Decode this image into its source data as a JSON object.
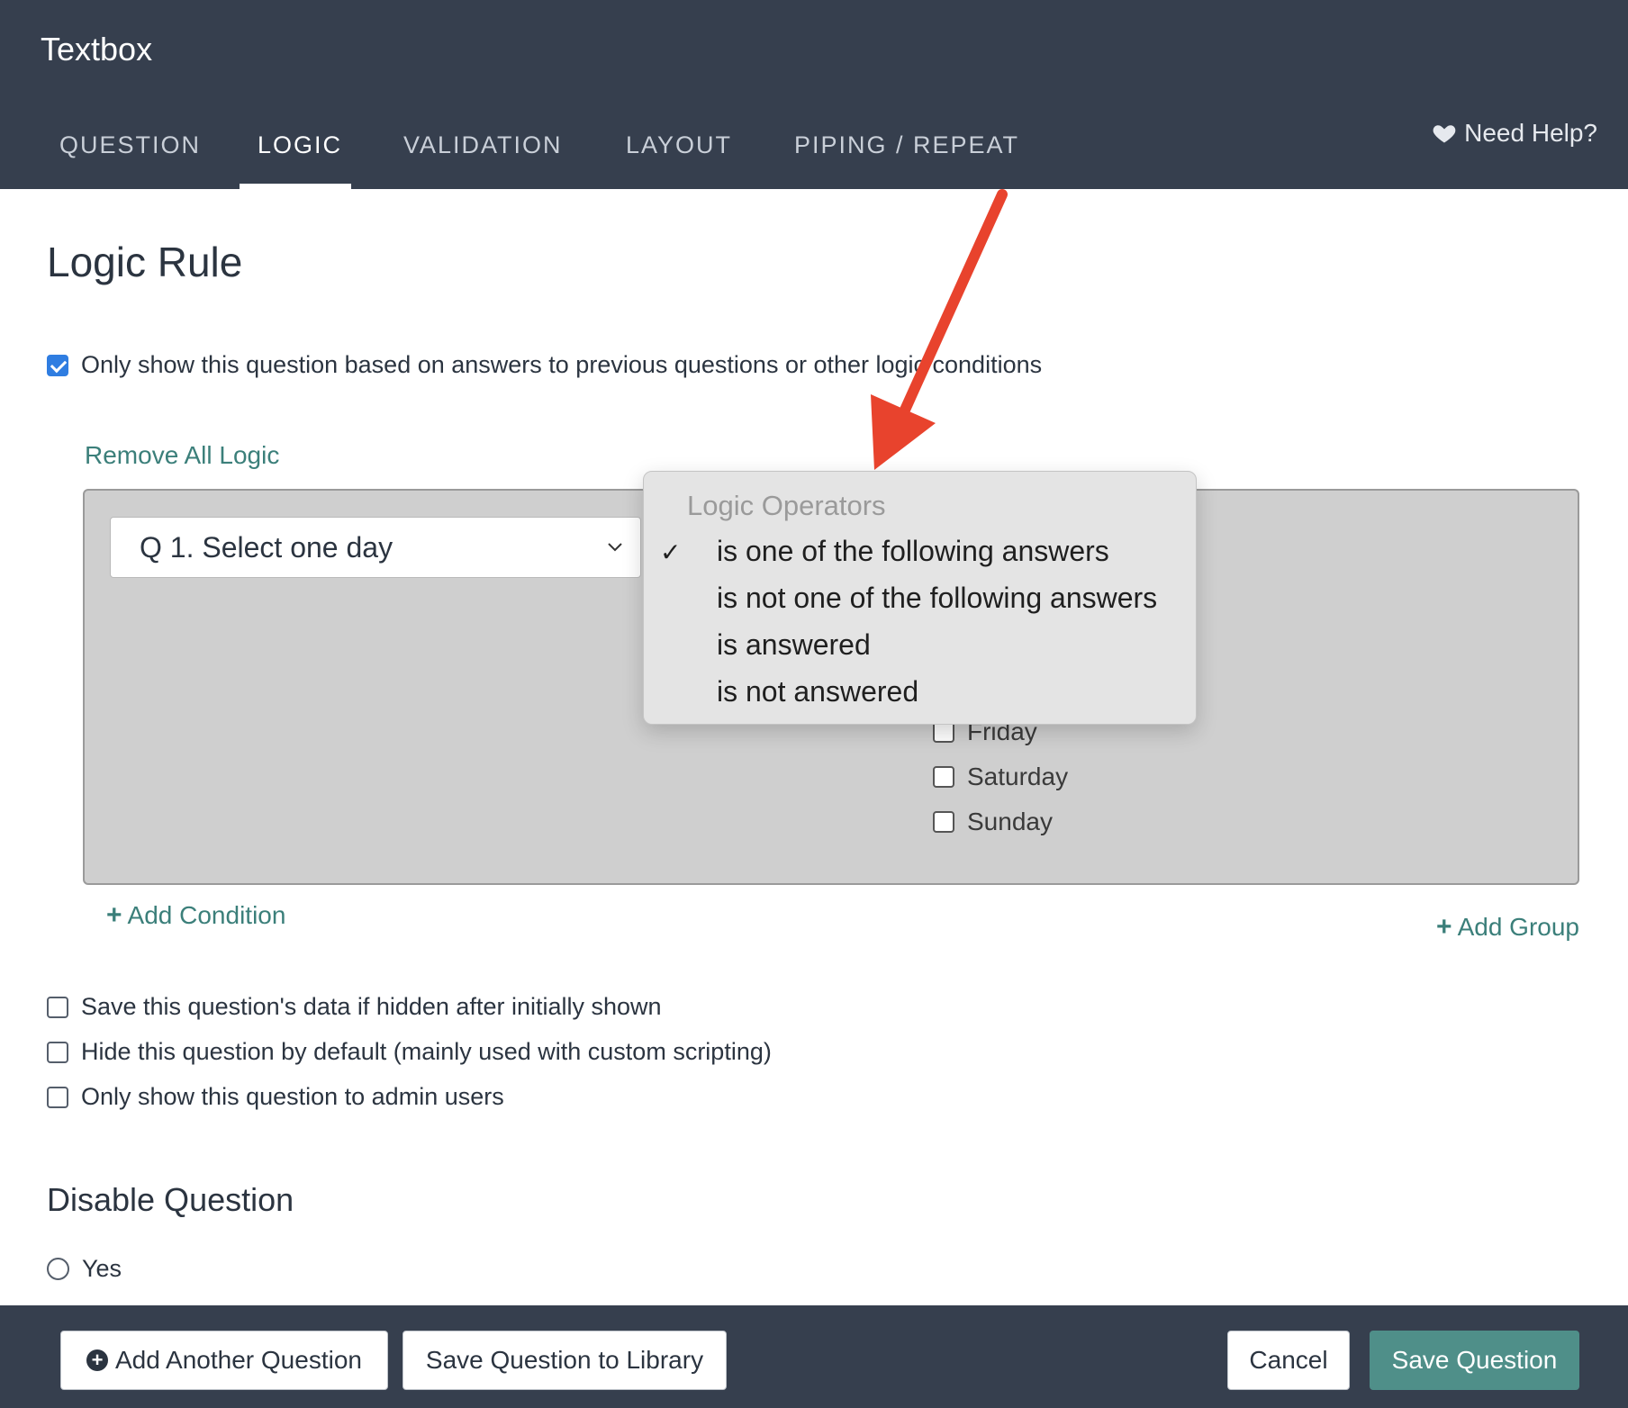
{
  "header": {
    "title": "Textbox",
    "tabs": [
      {
        "label": "QUESTION"
      },
      {
        "label": "LOGIC"
      },
      {
        "label": "VALIDATION"
      },
      {
        "label": "LAYOUT"
      },
      {
        "label": "PIPING / REPEAT"
      }
    ],
    "active_tab": "LOGIC",
    "need_help": "Need Help?"
  },
  "logic_rule": {
    "title": "Logic Rule",
    "only_show_label": "Only show this question based on answers to previous questions or other logic conditions",
    "only_show_checked": true,
    "remove_all": "Remove All Logic",
    "question_select": "Q 1. Select one day",
    "days": [
      {
        "label": "Friday",
        "checked": false
      },
      {
        "label": "Saturday",
        "checked": false
      },
      {
        "label": "Sunday",
        "checked": false
      }
    ],
    "add_condition": "Add Condition",
    "add_group": "Add Group"
  },
  "operators_dropdown": {
    "group_label": "Logic Operators",
    "options": [
      {
        "label": "is one of the following answers",
        "selected": true
      },
      {
        "label": "is not one of the following answers",
        "selected": false
      },
      {
        "label": "is answered",
        "selected": false
      },
      {
        "label": "is not answered",
        "selected": false
      }
    ],
    "check_mark": "✓"
  },
  "options": [
    {
      "label": "Save this question's data if hidden after initially shown",
      "checked": false
    },
    {
      "label": "Hide this question by default (mainly used with custom scripting)",
      "checked": false
    },
    {
      "label": "Only show this question to admin users",
      "checked": false
    }
  ],
  "disable_question": {
    "title": "Disable Question",
    "yes_label": "Yes"
  },
  "footer": {
    "add_another": "Add Another Question",
    "save_library": "Save Question to Library",
    "cancel": "Cancel",
    "save_question": "Save Question"
  },
  "colors": {
    "header_bg": "#363f4e",
    "accent_teal": "#4f8f89",
    "link_teal": "#3b7f7a",
    "checkbox_blue": "#2f7de1",
    "annotation_red": "#e8432d"
  }
}
